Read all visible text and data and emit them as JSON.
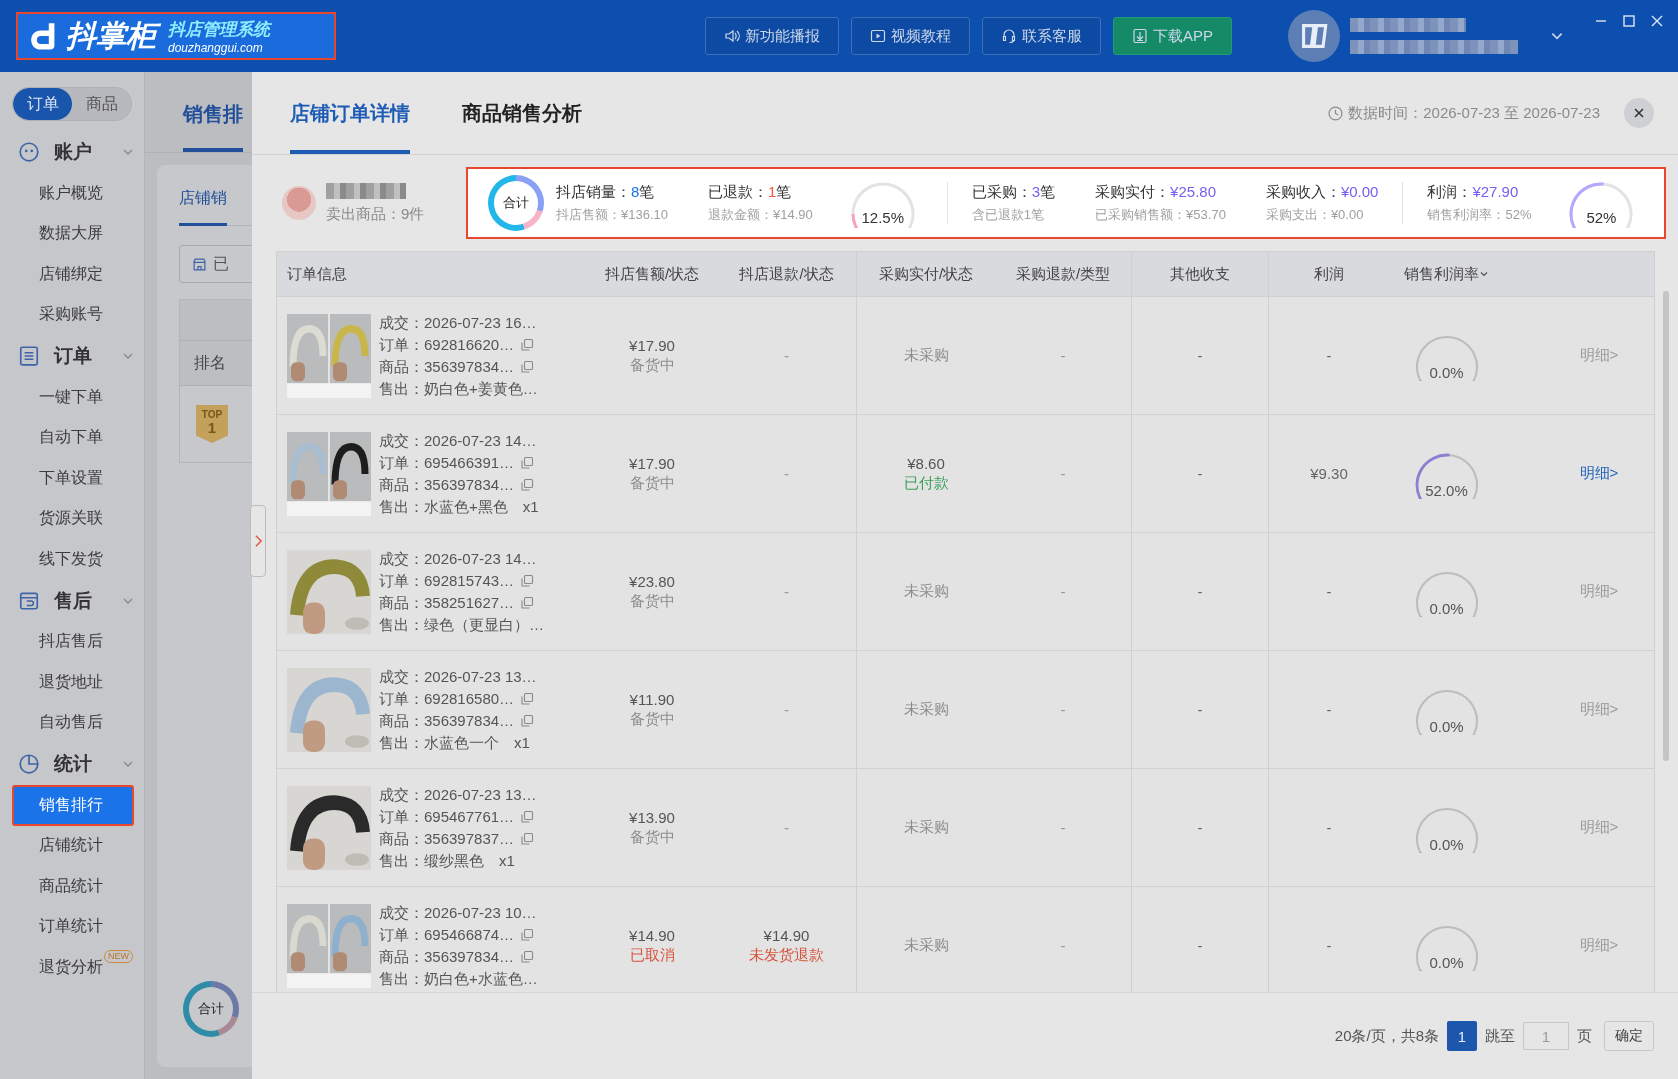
{
  "app": {
    "logo_title": "抖掌柜",
    "logo_subtitle": "抖店管理系统",
    "logo_url": "douzhanggui.com"
  },
  "header_buttons": [
    {
      "label": "新功能播报",
      "kind": "speaker"
    },
    {
      "label": "视频教程",
      "kind": "video"
    },
    {
      "label": "联系客服",
      "kind": "support"
    },
    {
      "label": "下载APP",
      "kind": "download"
    }
  ],
  "sidebar": {
    "mode_tabs": [
      {
        "label": "订单",
        "selected": true
      },
      {
        "label": "商品",
        "selected": false
      }
    ],
    "groups": [
      {
        "label": "账户",
        "expanded": true,
        "items": [
          {
            "label": "账户概览",
            "selected": false
          },
          {
            "label": "数据大屏",
            "selected": false
          },
          {
            "label": "店铺绑定",
            "selected": false
          },
          {
            "label": "采购账号",
            "selected": false
          }
        ]
      },
      {
        "label": "订单",
        "expanded": true,
        "items": [
          {
            "label": "一键下单",
            "selected": false
          },
          {
            "label": "自动下单",
            "selected": false
          },
          {
            "label": "下单设置",
            "selected": false
          },
          {
            "label": "货源关联",
            "selected": false
          },
          {
            "label": "线下发货",
            "selected": false
          }
        ]
      },
      {
        "label": "售后",
        "expanded": true,
        "items": [
          {
            "label": "抖店售后",
            "selected": false
          },
          {
            "label": "退货地址",
            "selected": false
          },
          {
            "label": "自动售后",
            "selected": false
          }
        ]
      },
      {
        "label": "统计",
        "expanded": true,
        "items": [
          {
            "label": "销售排行",
            "selected": true
          },
          {
            "label": "店铺统计",
            "selected": false
          },
          {
            "label": "商品统计",
            "selected": false
          },
          {
            "label": "订单统计",
            "selected": false
          },
          {
            "label": "退货分析",
            "selected": false,
            "badge": "NEW"
          }
        ]
      }
    ]
  },
  "background_page": {
    "tab": "销售排",
    "sub_tab": "店铺销",
    "filter_button": "已",
    "column": "排名",
    "rank_badge": {
      "top": "TOP",
      "number": "1"
    },
    "total_label": "合计"
  },
  "drawer": {
    "tabs": [
      {
        "label": "店铺订单详情",
        "selected": true
      },
      {
        "label": "商品销售分析",
        "selected": false
      }
    ],
    "data_time": "数据时间：2026-07-23 至 2026-07-23",
    "shop": {
      "sold": "卖出商品：9件"
    },
    "summary": {
      "total_label": "合计",
      "sections": [
        {
          "stats": [
            {
              "label": "抖店销量：",
              "value": "8",
              "unit": "笔",
              "color": "#1a73e8",
              "sub": "抖店售额：¥136.10"
            },
            {
              "label": "已退款：",
              "value": "1",
              "unit": "笔",
              "color": "#f0553a",
              "sub": "退款金额：¥14.90"
            }
          ],
          "gauge": {
            "reading": "12.5%",
            "level": 0.125,
            "color": "#f7a1bd"
          }
        },
        {
          "stats": [
            {
              "label": "已采购：",
              "value": "3",
              "unit": "笔",
              "color": "#7a5cf0",
              "sub": "含已退款1笔"
            },
            {
              "label": "采购实付：",
              "value": "¥25.80",
              "color": "#7a5cf0",
              "sub": "已采购销售额：¥53.70"
            },
            {
              "label": "采购收入：",
              "value": "¥0.00",
              "color": "#7a5cf0",
              "sub": "采购支出：¥0.00"
            }
          ]
        },
        {
          "stats": [
            {
              "label": "利润：",
              "value": "¥27.90",
              "color": "#7a5cf0",
              "sub": "销售利润率：52%"
            }
          ],
          "gauge": {
            "reading": "52%",
            "level": 0.52,
            "color": "#b7a6ff"
          }
        }
      ]
    },
    "table": {
      "columns": [
        {
          "label": "订单信息",
          "sortable": false
        },
        {
          "label": "抖店售额/状态",
          "sortable": false
        },
        {
          "label": "抖店退款/状态",
          "sortable": false
        },
        {
          "label": "采购实付/状态",
          "sortable": false
        },
        {
          "label": "采购退款/类型",
          "sortable": false
        },
        {
          "label": "其他收支",
          "sortable": false
        },
        {
          "label": "利润",
          "sortable": false
        },
        {
          "label": "销售利润率",
          "sortable": true
        }
      ],
      "rows": [
        {
          "deal": "成交：2026-07-23 16…",
          "order": "订单：692816620…",
          "product": "商品：356397834…",
          "sold": "售出：奶白色+姜黄色…",
          "sale": {
            "amount": "¥17.90",
            "status": "备货中",
            "color": "#8d8d8d"
          },
          "refund": {
            "status": "-",
            "color": "#9a9a9a"
          },
          "purchase": {
            "status": "未采购",
            "color": "#8d8d8d"
          },
          "purchase_refund": "-",
          "other": "-",
          "profit": "-",
          "margin": {
            "reading": "0.0%",
            "level": 0
          },
          "detail": {
            "label": "明细>",
            "active": false
          }
        },
        {
          "deal": "成交：2026-07-23 14…",
          "order": "订单：695466391…",
          "product": "商品：356397834…",
          "sold": "售出：水蓝色+黑色　x1",
          "sale": {
            "amount": "¥17.90",
            "status": "备货中",
            "color": "#8d8d8d"
          },
          "refund": {
            "status": "-",
            "color": "#9a9a9a"
          },
          "purchase": {
            "amount": "¥8.60",
            "status": "已付款",
            "color": "#3aa05a"
          },
          "purchase_refund": "-",
          "other": "-",
          "profit": "¥9.30",
          "margin": {
            "reading": "52.0%",
            "level": 0.52
          },
          "detail": {
            "label": "明细>",
            "active": true
          }
        },
        {
          "deal": "成交：2026-07-23 14…",
          "order": "订单：692815743…",
          "product": "商品：358251627…",
          "sold": "售出：绿色（更显白）…",
          "sale": {
            "amount": "¥23.80",
            "status": "备货中",
            "color": "#8d8d8d"
          },
          "refund": {
            "status": "-",
            "color": "#9a9a9a"
          },
          "purchase": {
            "status": "未采购",
            "color": "#8d8d8d"
          },
          "purchase_refund": "-",
          "other": "-",
          "profit": "-",
          "margin": {
            "reading": "0.0%",
            "level": 0
          },
          "detail": {
            "label": "明细>",
            "active": false
          }
        },
        {
          "deal": "成交：2026-07-23 13…",
          "order": "订单：692816580…",
          "product": "商品：356397834…",
          "sold": "售出：水蓝色一个　x1",
          "sale": {
            "amount": "¥11.90",
            "status": "备货中",
            "color": "#8d8d8d"
          },
          "refund": {
            "status": "-",
            "color": "#9a9a9a"
          },
          "purchase": {
            "status": "未采购",
            "color": "#8d8d8d"
          },
          "purchase_refund": "-",
          "other": "-",
          "profit": "-",
          "margin": {
            "reading": "0.0%",
            "level": 0
          },
          "detail": {
            "label": "明细>",
            "active": false
          }
        },
        {
          "deal": "成交：2026-07-23 13…",
          "order": "订单：695467761…",
          "product": "商品：356397837…",
          "sold": "售出：缎纱黑色　x1",
          "sale": {
            "amount": "¥13.90",
            "status": "备货中",
            "color": "#8d8d8d"
          },
          "refund": {
            "status": "-",
            "color": "#9a9a9a"
          },
          "purchase": {
            "status": "未采购",
            "color": "#8d8d8d"
          },
          "purchase_refund": "-",
          "other": "-",
          "profit": "-",
          "margin": {
            "reading": "0.0%",
            "level": 0
          },
          "detail": {
            "label": "明细>",
            "active": false
          }
        },
        {
          "deal": "成交：2026-07-23 10…",
          "order": "订单：695466874…",
          "product": "商品：356397834…",
          "sold": "售出：奶白色+水蓝色…",
          "sale": {
            "amount": "¥14.90",
            "status": "已取消",
            "color": "#d6533d"
          },
          "refund": {
            "amount": "¥14.90",
            "status": "未发货退款",
            "color": "#d6533d"
          },
          "purchase": {
            "status": "未采购",
            "color": "#8d8d8d"
          },
          "purchase_refund": "-",
          "other": "-",
          "profit": "-",
          "margin": {
            "reading": "0.0%",
            "level": 0
          },
          "detail": {
            "label": "明细>",
            "active": false
          }
        }
      ]
    },
    "pagination": {
      "summary": "20条/页，共8条",
      "pages": [
        {
          "label": "1",
          "selected": true
        }
      ],
      "jump_label": "跳至",
      "jump_value": "1",
      "page_unit": "页",
      "confirm": "确定"
    }
  }
}
